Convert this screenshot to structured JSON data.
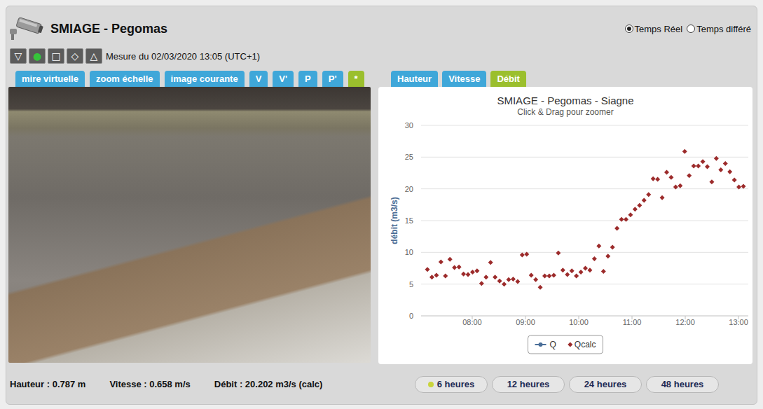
{
  "header": {
    "title": "SMIAGE - Pegomas",
    "mode_options": [
      {
        "label": "Temps Réel",
        "selected": true
      },
      {
        "label": "Temps différé",
        "selected": false
      }
    ]
  },
  "tool_buttons": [
    {
      "glyph": "▽",
      "color": "#ffffff"
    },
    {
      "glyph": "●",
      "color": "#35c43a"
    },
    {
      "glyph": "□",
      "color": "#ffffff"
    },
    {
      "glyph": "◇",
      "color": "#ffffff"
    },
    {
      "glyph": "△",
      "color": "#ffffff"
    }
  ],
  "measure": "Mesure du 02/03/2020 13:05 (UTC+1)",
  "image_tabs": [
    {
      "label": "mire virtuelle",
      "selected": false
    },
    {
      "label": "zoom échelle",
      "selected": false
    },
    {
      "label": "image courante",
      "selected": false
    },
    {
      "label": "V",
      "selected": false
    },
    {
      "label": "V'",
      "selected": false
    },
    {
      "label": "P",
      "selected": false
    },
    {
      "label": "P'",
      "selected": false
    },
    {
      "label": "*",
      "selected": true
    }
  ],
  "chart_tabs": [
    {
      "label": "Hauteur",
      "selected": false
    },
    {
      "label": "Vitesse",
      "selected": false
    },
    {
      "label": "Débit",
      "selected": true
    }
  ],
  "chart": {
    "title": "SMIAGE - Pegomas - Siagne",
    "subtitle": "Click & Drag pour zoomer",
    "y_axis_label": "débit (m3/s)",
    "y_ticks": [
      "0",
      "5",
      "10",
      "15",
      "20",
      "25",
      "30"
    ],
    "x_ticks": [
      "08:00",
      "09:00",
      "10:00",
      "11:00",
      "12:00",
      "13:00"
    ],
    "series": [
      {
        "name": "Q",
        "kind": "line",
        "color": "#4a6e98",
        "values": []
      },
      {
        "name": "Qcalc",
        "kind": "scatter",
        "color": "#9c2b2b",
        "values": [
          7.3,
          6.1,
          6.4,
          8.5,
          6.3,
          8.9,
          7.6,
          7.7,
          6.6,
          6.5,
          6.9,
          7.1,
          5.1,
          6.1,
          8.4,
          6.1,
          5.5,
          5.0,
          5.7,
          5.8,
          5.4,
          9.6,
          9.7,
          6.4,
          5.7,
          4.5,
          6.3,
          6.3,
          6.4,
          9.9,
          7.2,
          6.5,
          7.1,
          6.3,
          6.9,
          7.5,
          7.2,
          9.0,
          11.0,
          7.0,
          9.4,
          10.8,
          13.8,
          15.2,
          15.2,
          15.9,
          16.8,
          17.4,
          18.2,
          19.1,
          21.6,
          21.5,
          18.6,
          22.6,
          21.8,
          20.3,
          20.5,
          25.9,
          22.1,
          23.6,
          23.6,
          24.3,
          23.5,
          21.1,
          24.8,
          23.0,
          24.0,
          22.7,
          21.4,
          20.3,
          20.4
        ]
      }
    ]
  },
  "readings": [
    "Hauteur : 0.787 m",
    "Vitesse : 0.658 m/s",
    "Débit : 20.202 m3/s (calc)"
  ],
  "period_buttons": [
    {
      "label": "6 heures",
      "selected": true
    },
    {
      "label": "12 heures",
      "selected": false
    },
    {
      "label": "24 heures",
      "selected": false
    },
    {
      "label": "48 heures",
      "selected": false
    }
  ]
}
